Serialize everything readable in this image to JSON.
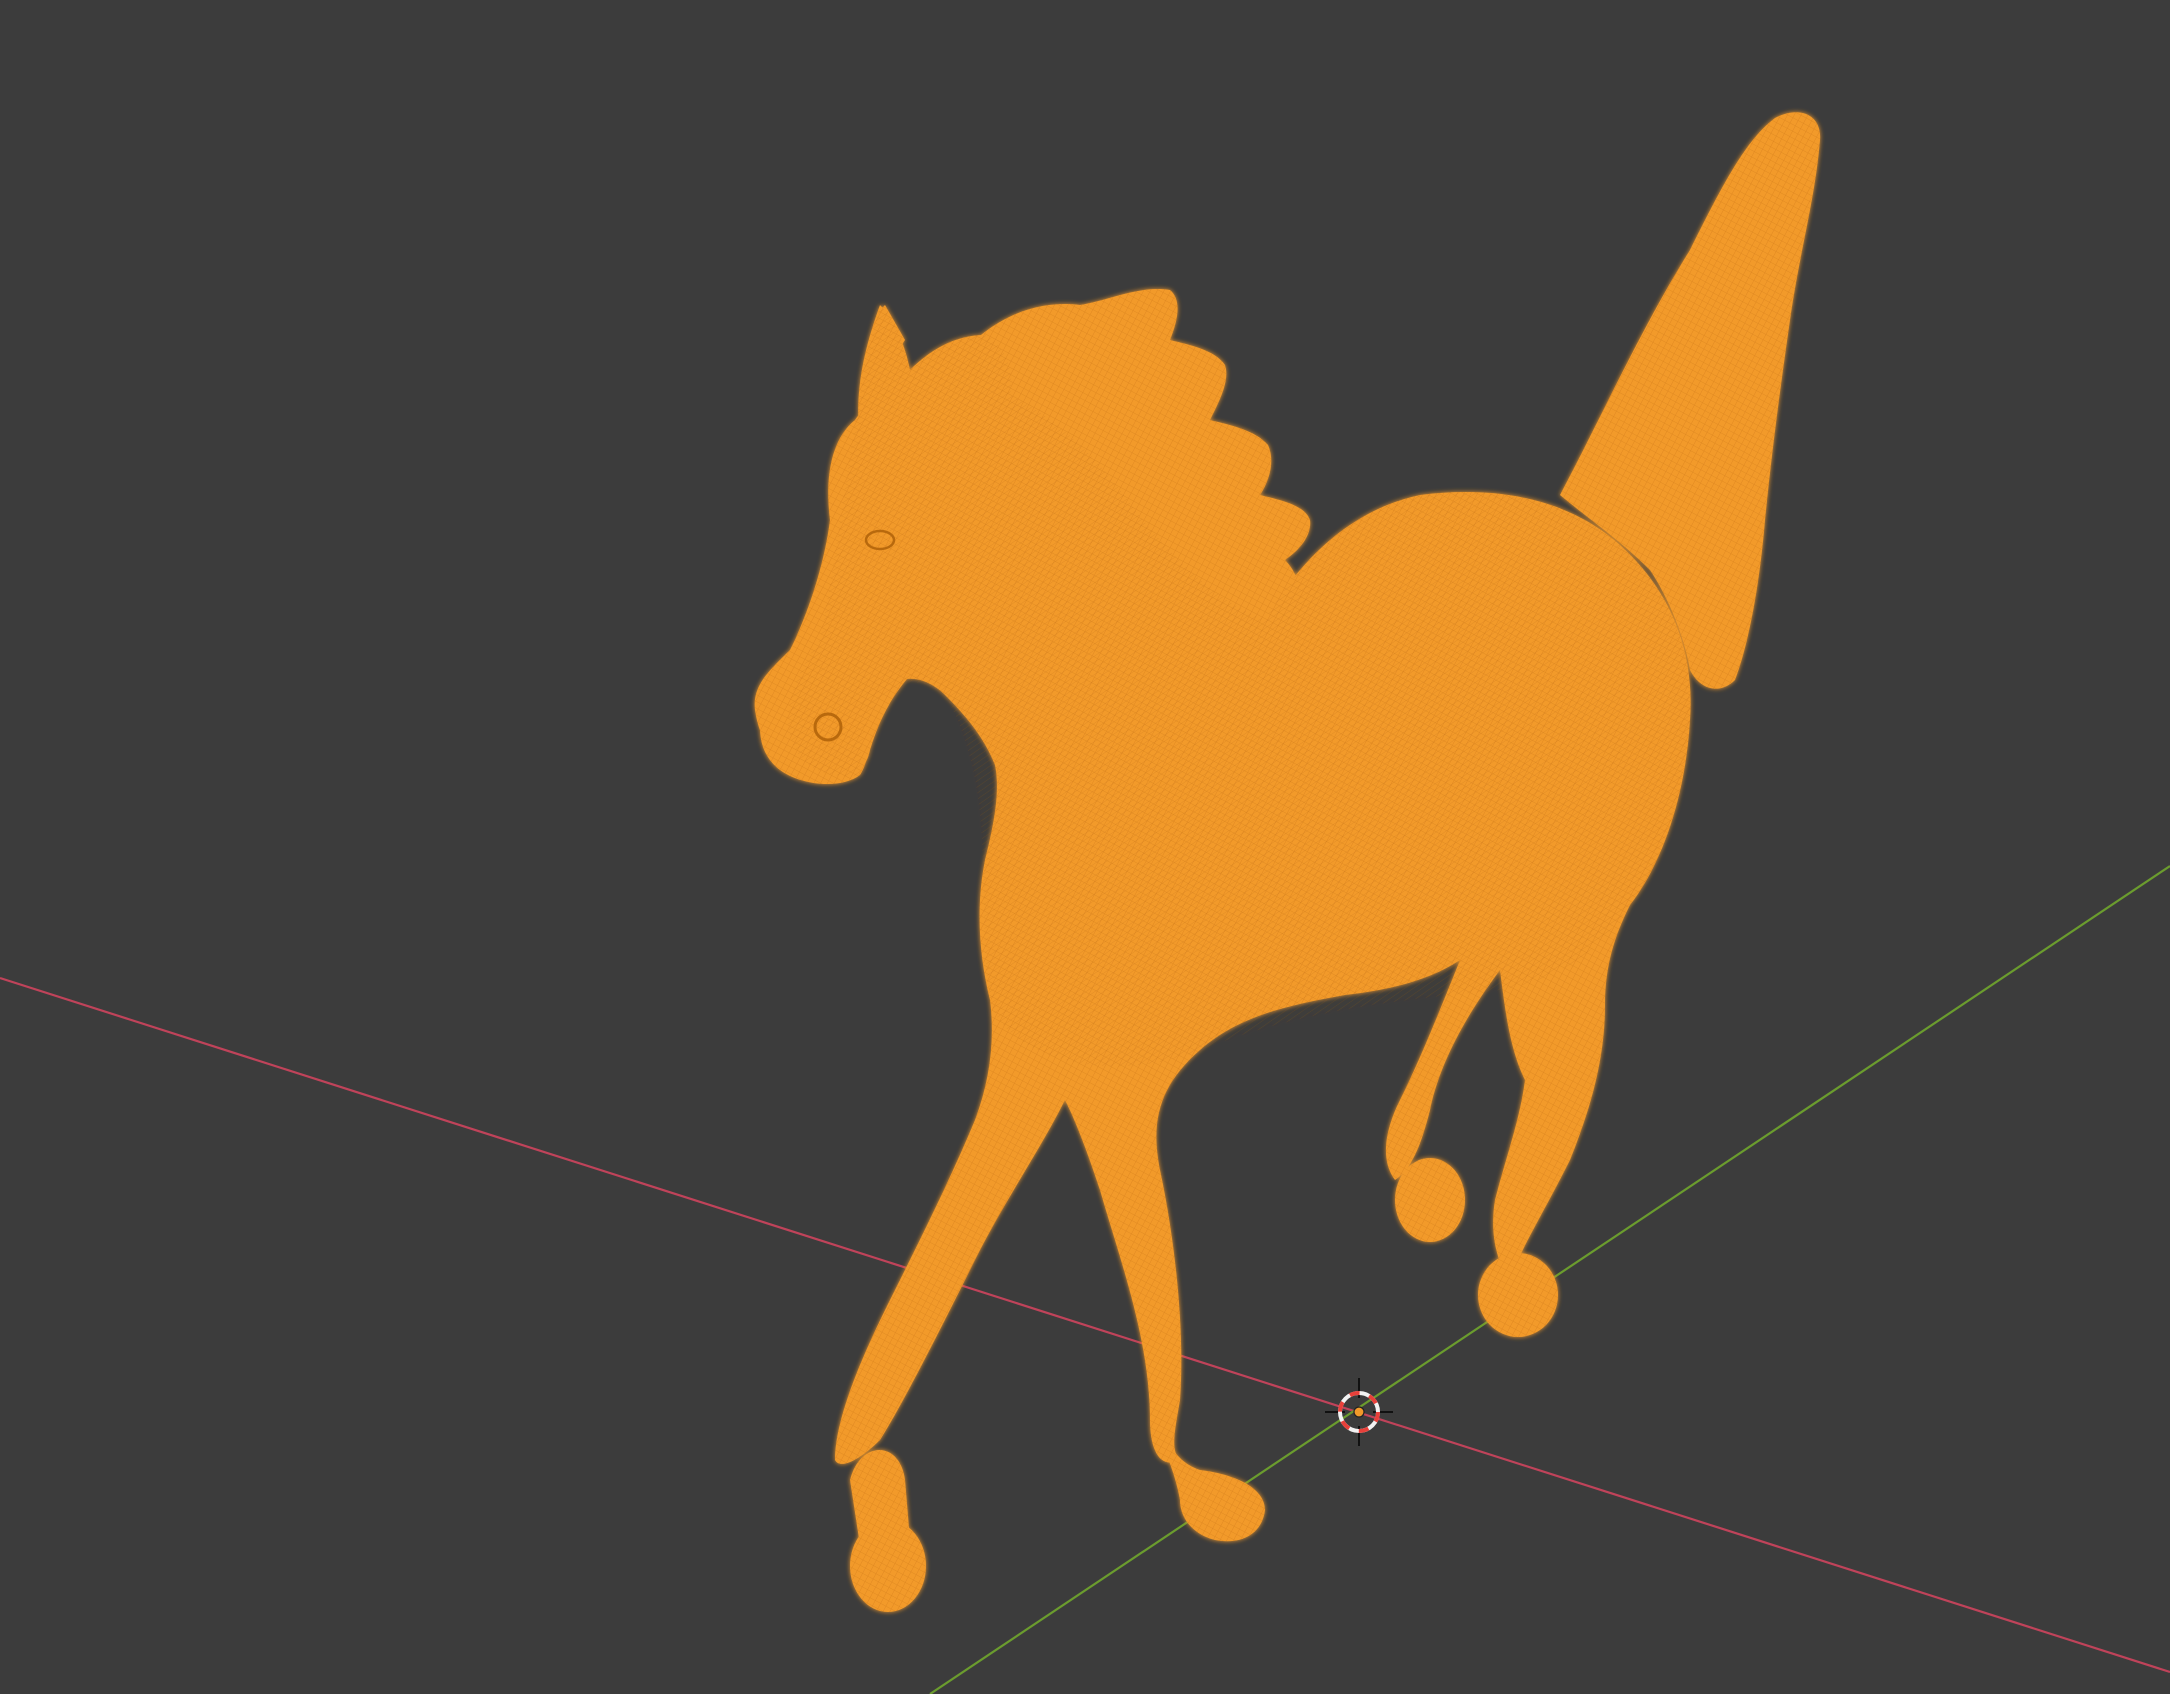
{
  "app": {
    "editor": "3D Viewport",
    "viewport_background": "#3c3c3c"
  },
  "viewport": {
    "shading": "wireframe",
    "x_axis_color": "#c0435a",
    "y_axis_color": "#6b9c2e",
    "selected_object": {
      "name_icon": "horse-mesh",
      "wire_color": "#f19a2a",
      "selected": true
    },
    "cursor": {
      "icon": "3d-cursor-icon",
      "ring_color_a": "#e8403a",
      "ring_color_b": "#f2f2f2"
    },
    "origin": {
      "icon": "object-origin-icon",
      "color": "#f19a2a"
    }
  }
}
